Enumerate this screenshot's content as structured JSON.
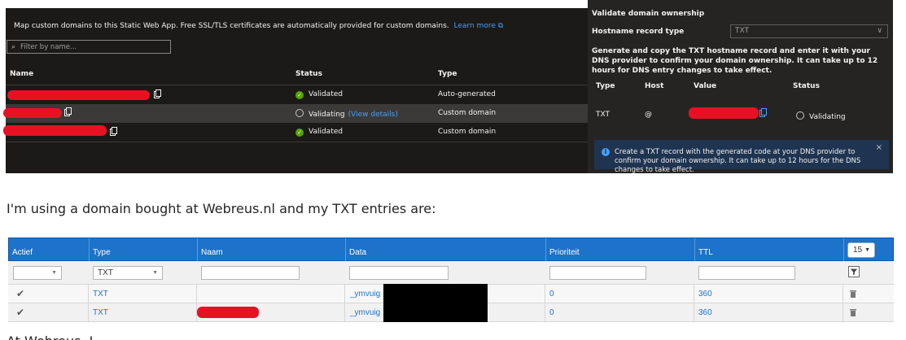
{
  "azure_panel": {
    "description": "Map custom domains to this Static Web App. Free SSL/TLS certificates are automatically provided for custom domains.",
    "learn_more": "Learn more",
    "filter_placeholder": "Filter by name...",
    "columns": {
      "name": "Name",
      "status": "Status",
      "type": "Type"
    },
    "rows": [
      {
        "status": "Validated",
        "type": "Auto-generated"
      },
      {
        "status": "Validating",
        "link": "(View details)",
        "type": "Custom domain"
      },
      {
        "status": "Validated",
        "type": "Custom domain"
      }
    ]
  },
  "validate_panel": {
    "title": "Validate domain ownership",
    "record_type_label": "Hostname record type",
    "record_type_value": "TXT",
    "instructions": "Generate and copy the TXT hostname record and enter it with your DNS provider to confirm your domain ownership. It can take up to 12 hours for DNS entry changes to take effect.",
    "columns": {
      "type": "Type",
      "host": "Host",
      "value": "Value",
      "status": "Status"
    },
    "record": {
      "type": "TXT",
      "host": "@",
      "status": "Validating"
    },
    "info": "Create a TXT record with the generated code at your DNS provider to confirm your domain ownership. It can take up to 12 hours for the DNS changes to take effect.",
    "close": "×"
  },
  "question": "I'm using a domain bought at Webreus.nl and my TXT entries are:",
  "webreus_table": {
    "columns": [
      "Actief",
      "Type",
      "Naam",
      "Data",
      "Prioriteit",
      "TTL"
    ],
    "page_size": "15",
    "type_filter": "TXT",
    "rows": [
      {
        "type": "TXT",
        "data": "_ymvuig",
        "priority": "0",
        "ttl": "360"
      },
      {
        "type": "TXT",
        "data": "_ymvuig",
        "priority": "0",
        "ttl": "360"
      }
    ]
  },
  "tail_text": "At Webreus, I"
}
